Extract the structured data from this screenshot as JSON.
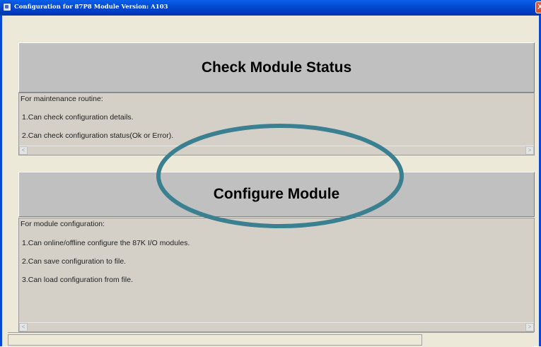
{
  "window": {
    "title": "Configuration for 87P8 Module Version: A103",
    "close_label": "X"
  },
  "status_section": {
    "button_label": "Check Module Status",
    "lines": [
      "For maintenance routine:",
      "1.Can check configuration details.",
      "2.Can check configuration status(Ok or Error)."
    ]
  },
  "config_section": {
    "button_label": "Configure Module",
    "lines": [
      "For module configuration:",
      "1.Can online/offline configure the 87K I/O modules.",
      "2.Can save configuration to file.",
      "3.Can load configuration from file."
    ]
  },
  "scroll_arrows": {
    "left": "<",
    "right": ">"
  },
  "colors": {
    "titlebar": "#0042c8",
    "button_face": "#c0c0c0",
    "panel_bg": "#d4d0c8",
    "highlight_ellipse": "#3b8091"
  }
}
